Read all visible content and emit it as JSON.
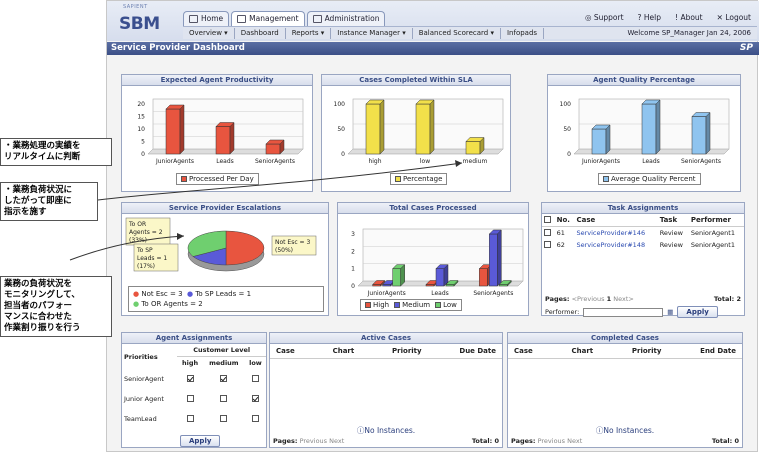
{
  "header": {
    "logo_small": "SAPIENT",
    "logo_big": "SBM",
    "tabs": [
      {
        "label": "Home",
        "icon": "home-icon"
      },
      {
        "label": "Management",
        "icon": "management-icon"
      },
      {
        "label": "Administration",
        "icon": "administration-icon"
      }
    ],
    "links": {
      "support": "Support",
      "help": "Help",
      "about": "About",
      "logout": "Logout"
    },
    "subnav": [
      "Overview ▾",
      "Dashboard",
      "Reports ▾",
      "Instance Manager ▾",
      "Balanced Scorecard ▾",
      "Infopads"
    ],
    "welcome": "Welcome SP_Manager  Jan 24, 2006"
  },
  "page": {
    "title": "Service Provider Dashboard",
    "brand": "SP"
  },
  "panels": {
    "productivity": {
      "title": "Expected Agent Productivity",
      "legend": "Processed Per Day"
    },
    "sla": {
      "title": "Cases Completed Within SLA",
      "legend": "Percentage"
    },
    "quality": {
      "title": "Agent Quality Percentage",
      "legend": "Average Quality Percent"
    },
    "escalations": {
      "title": "Service Provider Escalations",
      "labels": {
        "to_or": "To OR\nAgents = 2\n(33%)",
        "to_sp": "To SP\nLeads = 1\n(17%)",
        "not_esc": "Not Esc = 3\n(50%)"
      },
      "legend": [
        "Not Esc = 3",
        "To SP Leads = 1",
        "To OR Agents = 2"
      ]
    },
    "total_cases": {
      "title": "Total Cases Processed",
      "legend": [
        "High",
        "Medium",
        "Low"
      ]
    },
    "tasks": {
      "title": "Task Assignments",
      "columns": [
        "No.",
        "Case",
        "Task",
        "Performer"
      ],
      "rows": [
        {
          "no": "61",
          "case": "ServiceProvider#146",
          "task": "Review",
          "performer": "SeniorAgent1"
        },
        {
          "no": "62",
          "case": "ServiceProvider#148",
          "task": "Review",
          "performer": "SeniorAgent1"
        }
      ],
      "pages_label": "Pages:",
      "previous": "Previous",
      "page_num": "1",
      "next": "Next",
      "total": "Total: 2",
      "performer_label": "Performer:",
      "apply": "Apply"
    },
    "agent_assign": {
      "title": "Agent Assignments",
      "priorities": "Priorities",
      "customer_level": "Customer Level",
      "levels": [
        "high",
        "medium",
        "low"
      ],
      "rows": [
        {
          "name": "SeniorAgent",
          "checks": [
            true,
            true,
            false
          ]
        },
        {
          "name": "Junior Agent",
          "checks": [
            false,
            false,
            true
          ]
        },
        {
          "name": "TeamLead",
          "checks": [
            false,
            false,
            false
          ]
        }
      ],
      "apply": "Apply"
    },
    "active": {
      "title": "Active Cases",
      "columns": [
        "Case",
        "Chart",
        "Priority",
        "Due Date"
      ],
      "empty": "No Instances.",
      "pages_label": "Pages:",
      "prevnext": "Previous  Next",
      "total": "Total: 0"
    },
    "completed": {
      "title": "Completed Cases",
      "columns": [
        "Case",
        "Chart",
        "Priority",
        "End Date"
      ],
      "empty": "No Instances.",
      "pages_label": "Pages:",
      "prevnext": "Previous  Next",
      "total": "Total: 0"
    }
  },
  "callouts": [
    "・業務処理の実績を\nリアルタイムに判断",
    "・業務負荷状況に\nしたがって即座に\n指示を施す",
    "業務の負荷状況を\nモニタリングして、\n担当者のパフォー\nマンスに合わせた\n作業割り振りを行う"
  ],
  "colors": {
    "red": "#e8553f",
    "yellow": "#f2e04a",
    "blue": "#8fc4ef",
    "green": "#6fcf6f",
    "purple": "#5a5ad8",
    "accent": "#3b4f86"
  },
  "chart_data": [
    {
      "type": "bar",
      "title": "Expected Agent Productivity",
      "categories": [
        "JuniorAgents",
        "Leads",
        "SeniorAgents"
      ],
      "series": [
        {
          "name": "Processed Per Day",
          "values": [
            18,
            11,
            4
          ]
        }
      ],
      "ylim": [
        0,
        20
      ],
      "yticks": [
        0,
        5,
        10,
        15,
        20
      ]
    },
    {
      "type": "bar",
      "title": "Cases Completed Within SLA",
      "categories": [
        "high",
        "low",
        "medium"
      ],
      "series": [
        {
          "name": "Percentage",
          "values": [
            100,
            100,
            25
          ]
        }
      ],
      "ylim": [
        0,
        100
      ],
      "yticks": [
        0,
        50,
        100
      ]
    },
    {
      "type": "bar",
      "title": "Agent Quality Percentage",
      "categories": [
        "JuniorAgents",
        "Leads",
        "SeniorAgents"
      ],
      "series": [
        {
          "name": "Average Quality Percent",
          "values": [
            50,
            100,
            75
          ]
        }
      ],
      "ylim": [
        0,
        100
      ],
      "yticks": [
        0,
        50,
        100
      ]
    },
    {
      "type": "pie",
      "title": "Service Provider Escalations",
      "categories": [
        "Not Esc",
        "To SP Leads",
        "To OR Agents"
      ],
      "values": [
        3,
        1,
        2
      ]
    },
    {
      "type": "bar",
      "title": "Total Cases Processed",
      "categories": [
        "JuniorAgents",
        "Leads",
        "SeniorAgents"
      ],
      "series": [
        {
          "name": "High",
          "values": [
            0,
            0,
            1
          ]
        },
        {
          "name": "Medium",
          "values": [
            0,
            1,
            3
          ]
        },
        {
          "name": "Low",
          "values": [
            1,
            0,
            0
          ]
        }
      ],
      "ylim": [
        0,
        3
      ],
      "yticks": [
        0,
        1,
        2,
        3
      ]
    }
  ]
}
